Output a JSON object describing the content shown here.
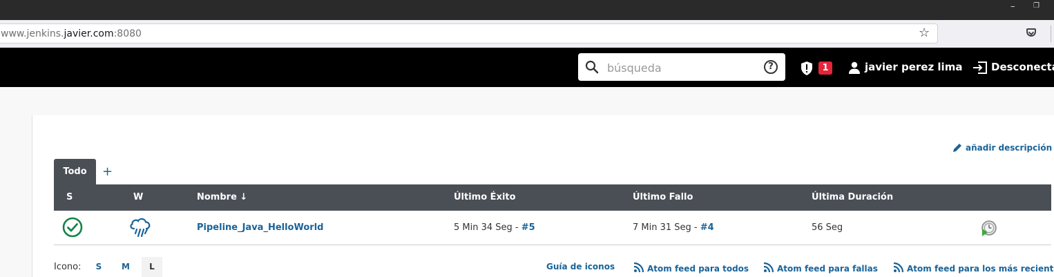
{
  "browser": {
    "url_prefix": "www.jenkins.",
    "url_domain": "javier.com",
    "url_suffix": ":8080"
  },
  "header": {
    "search_placeholder": "búsqueda",
    "alert_count": "1",
    "user_name": "javier perez lima",
    "logout_label": "Desconectar"
  },
  "actions": {
    "add_description": "añadir descripción"
  },
  "tabs": [
    {
      "label": "Todo"
    },
    {
      "label": "+"
    }
  ],
  "table": {
    "headers": [
      "S",
      "W",
      "Nombre ↓",
      "Último Éxito",
      "Último Fallo",
      "Última Duración"
    ],
    "rows": [
      {
        "status": "success",
        "weather": "rain",
        "name": "Pipeline_Java_HelloWorld",
        "last_success_text": "5 Min 34 Seg - ",
        "last_success_build": "#5",
        "last_failure_text": "7 Min 31 Seg - ",
        "last_failure_build": "#4",
        "last_duration": "56 Seg"
      }
    ]
  },
  "footer": {
    "icon_label": "Icono:",
    "sizes": [
      "S",
      "M",
      "L"
    ],
    "selected_size": "L",
    "links": [
      "Guía de iconos",
      "Atom feed para todos",
      "Atom feed para fallas",
      "Atom feed para los más recientes"
    ]
  },
  "colors": {
    "accent": "#1a6398",
    "success": "#138347",
    "header_bg": "#000000",
    "table_header_bg": "#4a4e55",
    "badge": "#e6243a"
  },
  "icons": [
    "star-icon",
    "pocket-icon",
    "search-icon",
    "help-icon",
    "shield-icon",
    "user-icon",
    "logout-icon",
    "pencil-icon",
    "success-icon",
    "weather-rain-icon",
    "schedule-build-icon",
    "rss-icon"
  ]
}
